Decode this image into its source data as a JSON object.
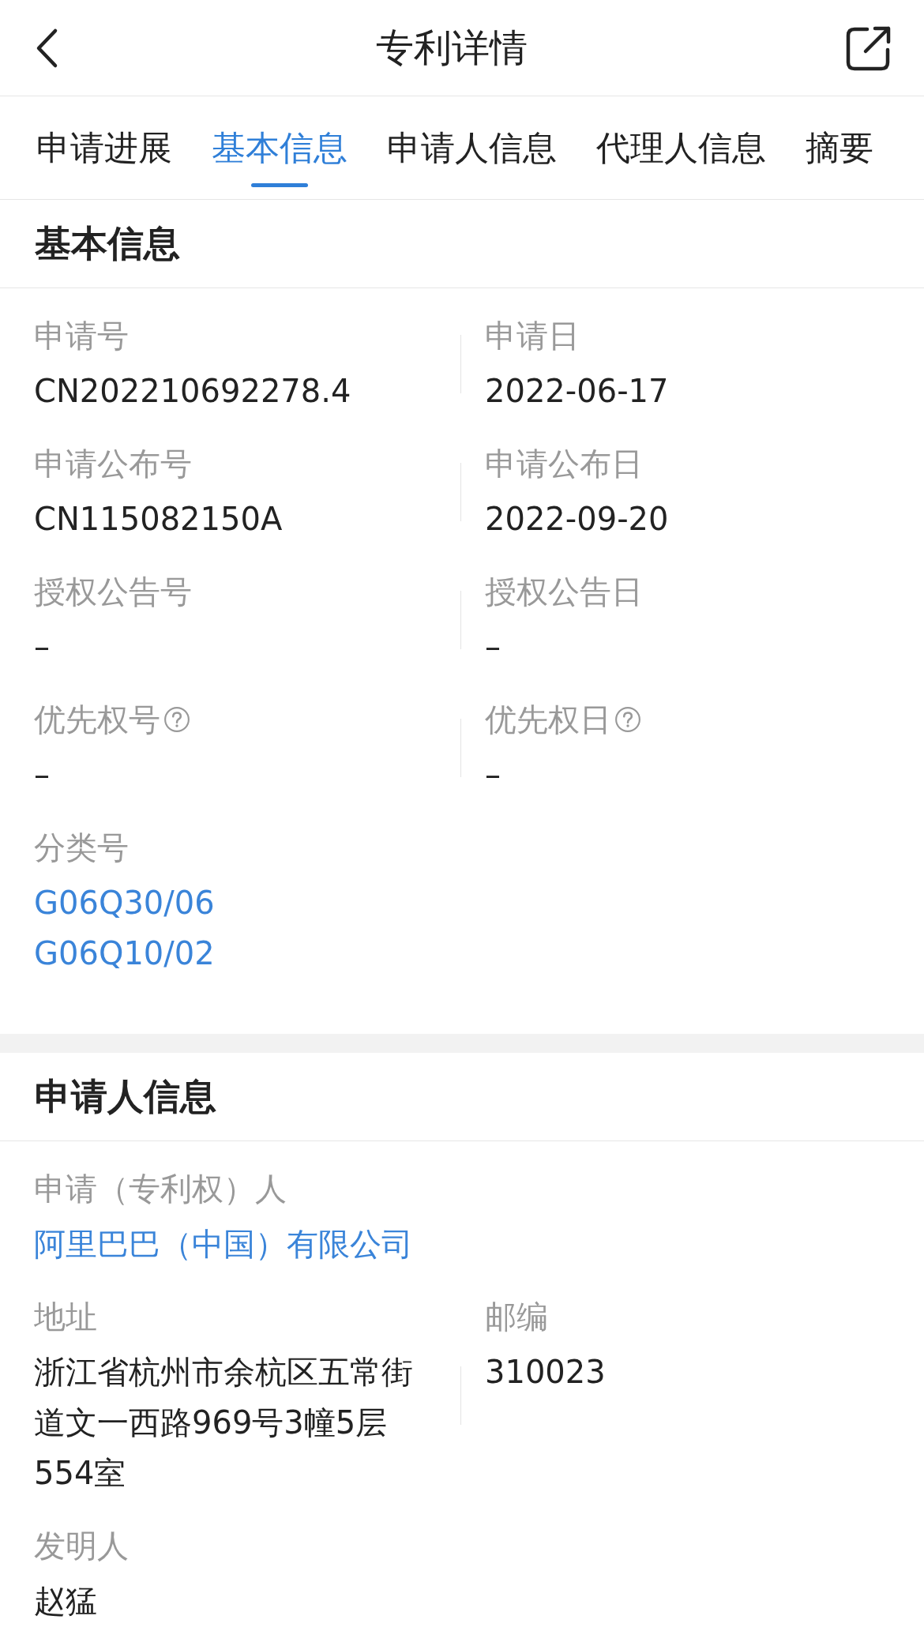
{
  "header": {
    "title": "专利详情"
  },
  "tabs": [
    {
      "label": "申请进展",
      "selected": false
    },
    {
      "label": "基本信息",
      "selected": true
    },
    {
      "label": "申请人信息",
      "selected": false
    },
    {
      "label": "代理人信息",
      "selected": false
    },
    {
      "label": "摘要",
      "selected": false
    }
  ],
  "sections": [
    {
      "title": "基本信息",
      "rows": [
        {
          "cells": [
            {
              "label": "申请号",
              "values": [
                "CN202210692278.4"
              ]
            },
            {
              "label": "申请日",
              "values": [
                "2022-06-17"
              ]
            }
          ]
        },
        {
          "cells": [
            {
              "label": "申请公布号",
              "values": [
                "CN115082150A"
              ]
            },
            {
              "label": "申请公布日",
              "values": [
                "2022-09-20"
              ]
            }
          ]
        },
        {
          "cells": [
            {
              "label": "授权公告号",
              "values": [
                "–"
              ]
            },
            {
              "label": "授权公告日",
              "values": [
                "–"
              ]
            }
          ]
        },
        {
          "cells": [
            {
              "label": "优先权号",
              "help": true,
              "values": [
                "–"
              ]
            },
            {
              "label": "优先权日",
              "help": true,
              "values": [
                "–"
              ]
            }
          ]
        },
        {
          "cells": [
            {
              "label": "分类号",
              "link": true,
              "values": [
                "G06Q30/06",
                "G06Q10/02"
              ]
            }
          ]
        }
      ]
    },
    {
      "title": "申请人信息",
      "rows": [
        {
          "cells": [
            {
              "label": "申请（专利权）人",
              "link": true,
              "values": [
                "阿里巴巴（中国）有限公司"
              ]
            }
          ]
        },
        {
          "cells": [
            {
              "label": "地址",
              "values": [
                "浙江省杭州市余杭区五常街道文一西路969号3幢5层554室"
              ]
            },
            {
              "label": "邮编",
              "values": [
                "310023"
              ]
            }
          ]
        },
        {
          "cells": [
            {
              "label": "发明人",
              "values": [
                "赵猛"
              ]
            }
          ]
        }
      ]
    }
  ]
}
